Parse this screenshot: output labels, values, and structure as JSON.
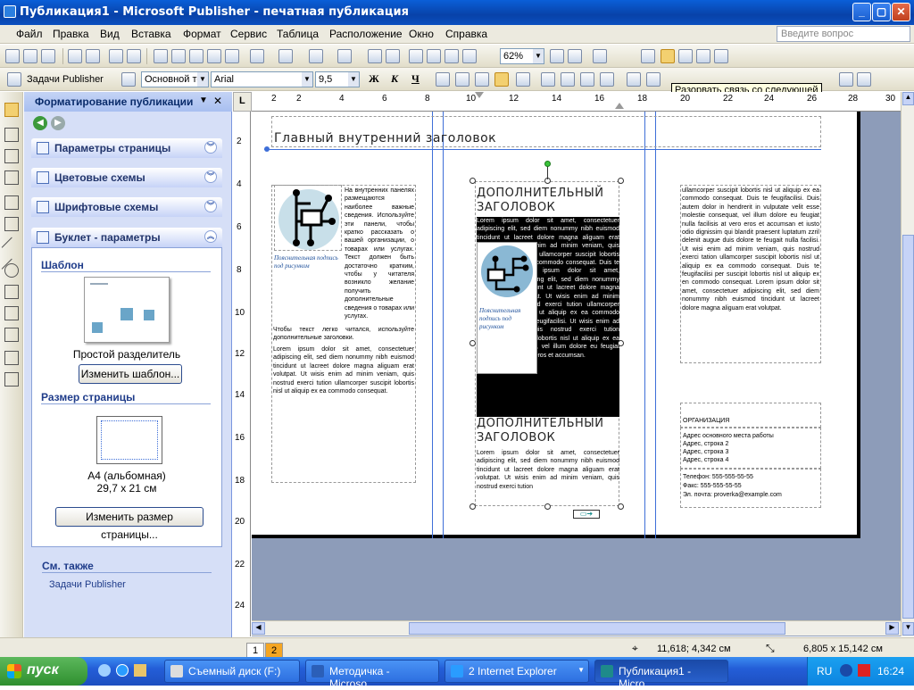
{
  "window": {
    "title": "Публикация1 - Microsoft Publisher - печатная публикация",
    "min": "_",
    "max": "▢",
    "close": "✕"
  },
  "menu": [
    "Файл",
    "Правка",
    "Вид",
    "Вставка",
    "Формат",
    "Сервис",
    "Таблица",
    "Расположение",
    "Окно",
    "Справка"
  ],
  "help_placeholder": "Введите вопрос",
  "toolbar1": {
    "zoom": "62%"
  },
  "toolbar2": {
    "tasks": "Задачи Publisher",
    "style": "Основной те",
    "font": "Arial",
    "size": "9,5",
    "bold": "Ж",
    "italic": "К",
    "underline": "Ч"
  },
  "tooltip": "Разорвать связь со следующей",
  "pane": {
    "title": "Форматирование публикации",
    "sections": [
      "Параметры страницы",
      "Цветовые схемы",
      "Шрифтовые схемы",
      "Буклет - параметры"
    ],
    "template_label": "Шаблон",
    "template_name": "Простой разделитель",
    "change_template": "Изменить шаблон...",
    "page_size_label": "Размер страницы",
    "page_size_name": "A4 (альбомная)",
    "page_size_dims": "29,7 x 21 см",
    "change_size": "Изменить размер страницы...",
    "see_also": "См. также",
    "tasks_link": "Задачи Publisher"
  },
  "hruler_ticks": [
    "2",
    "2",
    "4",
    "6",
    "8",
    "10",
    "12",
    "14",
    "16",
    "18",
    "20",
    "22",
    "24",
    "26",
    "28",
    "30"
  ],
  "vruler_ticks": [
    "2",
    "4",
    "6",
    "8",
    "10",
    "12",
    "14",
    "16",
    "18",
    "20",
    "22",
    "24"
  ],
  "doc": {
    "main_heading": "Главный внутренний заголовок",
    "col1_text": "На внутренних панелях размещаются наиболее важные сведения. Используйте эти панели, чтобы кратко рассказать о вашей организации, о товарах или услугах. Текст должен быть достаточно кратким, чтобы у читателя возникло желание получить дополнительные сведения о товарах или услугах.",
    "col1_caption": "Пояснительная подпись под рисунком",
    "col1_text2": "Чтобы текст легко читался, используйте дополнительные заголовки.",
    "col1_lorem": "Lorem ipsum dolor sit amet, consectetuer adipiscing elit, sed diem nonummy nibh euismod tincidunt ut lacreet dolore magna aliguam erat volutpat. Ut wisis enim ad minim veniam, quis nostrud exerci tution ullamcorper suscipit lobortis nisl ut aliquip ex ea commodo consequat.",
    "col2_heading": "ДОПОЛНИТЕЛЬНЫЙ ЗАГОЛОВОК",
    "col2_lorem": "Lorem ipsum dolor sit amet, consectetuer adipiscing elit, sed diem nonummy nibh euismod tincidunt ut lacreet dolore magna aliguam erat volutpat. Ut wisis enim ad minim veniam, quis nostrud exerci tution ullamcorper suscipit lobortis nisl ut aliquip ex ea commodo consequat. Duis te feugifacilisi. Lorem ipsum dolor sit amet, consectetuer adipiscing elit, sed diem nonummy nibh euismod tincidunt ut lacreet dolore magna aliguam erat volutpat. Ut wisis enim ad minim veniam, quis nostrud exerci tution ullamcorper suscipit lobortis nisl ut aliquip ex ea commodo consequat. Duis te feugifacilisi. Ut wisis enim ad minim veniam, quis nostrud exerci tution ullamcorper suscipit lobortis nisl ut aliquip ex ea commodo consequat, vel illum dolore eu feugiat nulla facilisis at vero eros et accumsan.",
    "col2_caption": "Пояснительная подпись под рисунком",
    "col2_heading2": "ДОПОЛНИТЕЛЬНЫЙ ЗАГОЛОВОК",
    "col2_lorem2": "Lorem ipsum dolor sit amet, consectetuer adipiscing elit, sed diem nonummy nibh euismod tincidunt ut lacreet dolore magna aliguam erat volutpat. Ut wisis enim ad minim veniam, quis nostrud exerci tution",
    "col3_lorem": "ullamcorper suscipit lobortis nisl ut aliquip ex ea commodo consequat. Duis te feugifacilisi. Duis autem dolor in hendrerit in vulputate velit esse molestie consequat, vel illum dolore eu feugiat nulla facilisis at vero eros et accumsan et iusto odio dignissim qui blandit praesent luptatum zzril delenit augue duis dolore te feugait nulla facilisi. Ut wisi enim ad minim veniam, quis nostrud exerci tation ullamcorper suscipit lobortis nisl ut aliquip ex ea commodo consequat. Duis te feugifacilisi per suscipit lobortis nisl ut aliquip ex en commodo consequat. Lorem ipsum dolor sit amet, consectetuer adipiscing elit, sed diem nonummy nibh euismod tincidunt ut lacreet dolore magna aliguam erat volutpat.",
    "org_name": "ОРГАНИЗАЦИЯ",
    "address": [
      "Адрес основного места работы",
      "Адрес, строка 2",
      "Адрес, строка 3",
      "Адрес, строка 4"
    ],
    "phone": "Телефон: 555-555-55-55",
    "fax": "Факс: 555-555-55-55",
    "email": "Эл. почта: proverka@example.com"
  },
  "status": {
    "page1": "1",
    "page2": "2",
    "pos": "11,618; 4,342 см",
    "size": "6,805 x 15,142 см"
  },
  "taskbar": {
    "start": "пуск",
    "tasks": [
      "Съемный диск (F:)",
      "Методичка - Microso...",
      "2 Internet Explorer",
      "Публикация1 - Micro..."
    ],
    "lang": "RU",
    "time": "16:24"
  }
}
